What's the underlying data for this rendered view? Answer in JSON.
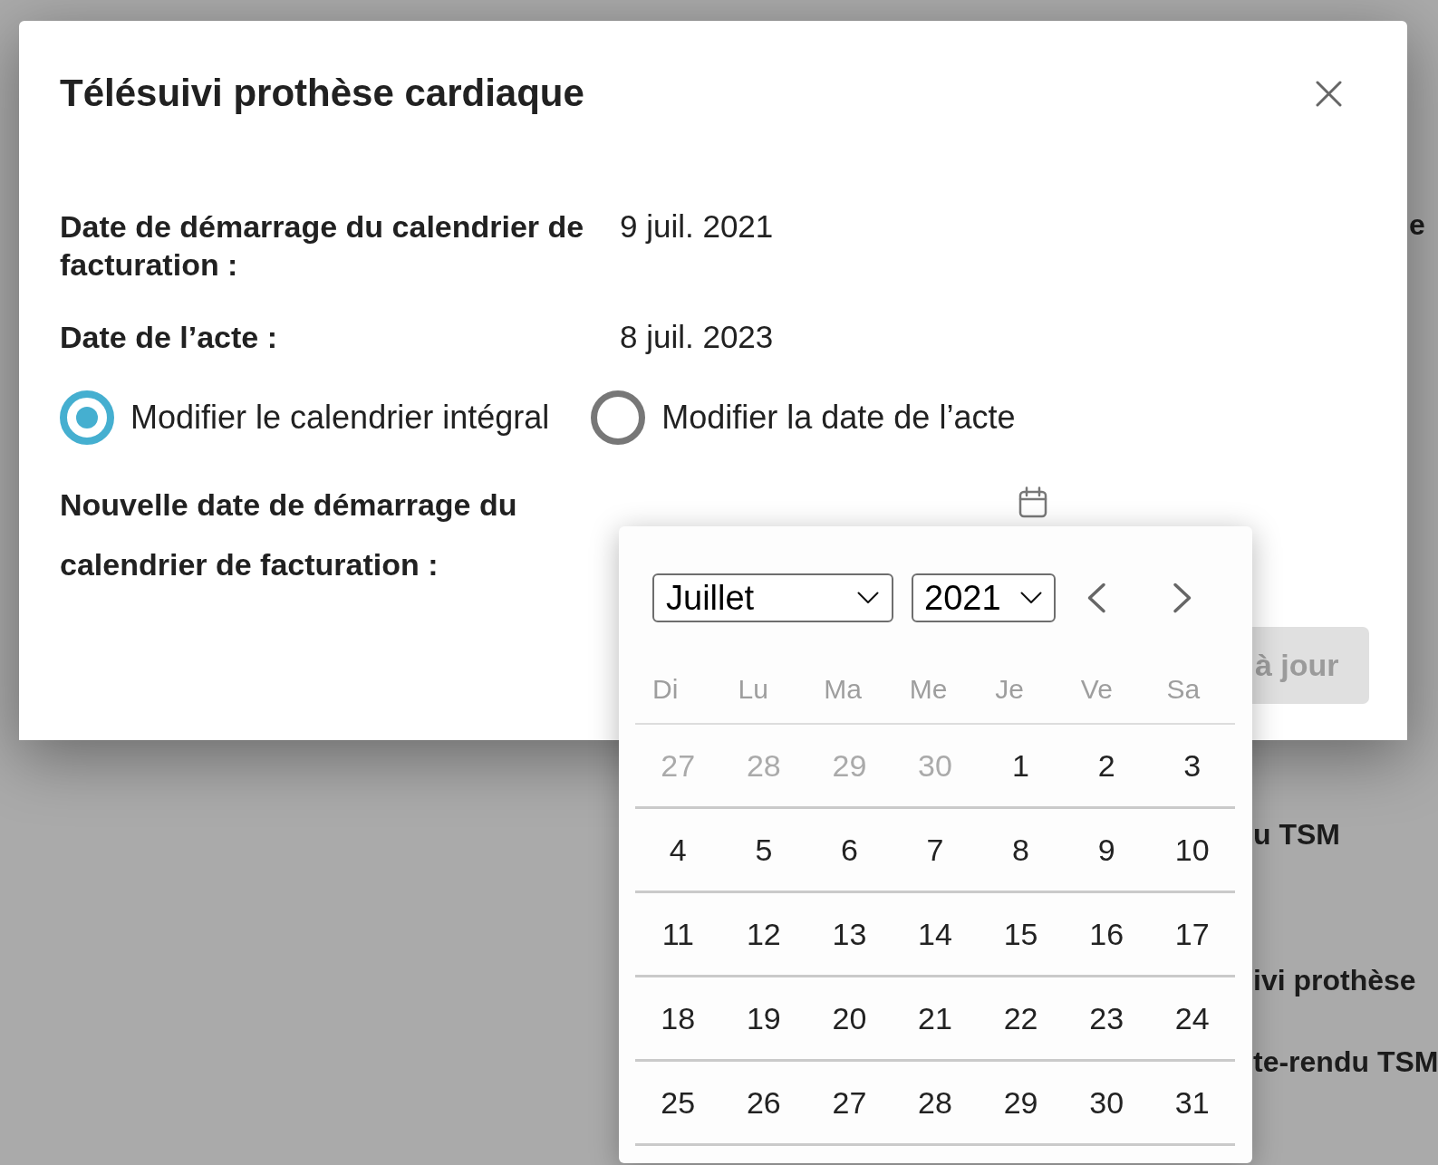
{
  "background_page": {
    "heading_fragment": "e",
    "list_fragments": [
      "u TSM",
      "ivi prothèse",
      "te-rendu TSM"
    ]
  },
  "dialog": {
    "title": "Télésuivi prothèse cardiaque",
    "fields": [
      {
        "label": "Date de démarrage du calendrier de facturation :",
        "value": "9 juil. 2021"
      },
      {
        "label": "Date de l’acte :",
        "value": "8 juil. 2023"
      }
    ],
    "mode_options": [
      {
        "label": "Modifier le calendrier intégral",
        "selected": true
      },
      {
        "label": "Modifier la date de l’acte",
        "selected": false
      }
    ],
    "new_start_date": {
      "label": "Nouvelle date de démarrage du calendrier de facturation :"
    },
    "submit_button": {
      "label": "à jour",
      "disabled": true
    }
  },
  "date_picker": {
    "month": "Juillet",
    "year": "2021",
    "weekdays": [
      "Di",
      "Lu",
      "Ma",
      "Me",
      "Je",
      "Ve",
      "Sa"
    ],
    "weeks": [
      [
        {
          "day": "27",
          "other_month": true
        },
        {
          "day": "28",
          "other_month": true
        },
        {
          "day": "29",
          "other_month": true
        },
        {
          "day": "30",
          "other_month": true
        },
        {
          "day": "1",
          "other_month": false
        },
        {
          "day": "2",
          "other_month": false
        },
        {
          "day": "3",
          "other_month": false
        }
      ],
      [
        {
          "day": "4",
          "other_month": false
        },
        {
          "day": "5",
          "other_month": false
        },
        {
          "day": "6",
          "other_month": false
        },
        {
          "day": "7",
          "other_month": false
        },
        {
          "day": "8",
          "other_month": false
        },
        {
          "day": "9",
          "other_month": false
        },
        {
          "day": "10",
          "other_month": false
        }
      ],
      [
        {
          "day": "11",
          "other_month": false
        },
        {
          "day": "12",
          "other_month": false
        },
        {
          "day": "13",
          "other_month": false
        },
        {
          "day": "14",
          "other_month": false
        },
        {
          "day": "15",
          "other_month": false
        },
        {
          "day": "16",
          "other_month": false
        },
        {
          "day": "17",
          "other_month": false
        }
      ],
      [
        {
          "day": "18",
          "other_month": false
        },
        {
          "day": "19",
          "other_month": false
        },
        {
          "day": "20",
          "other_month": false
        },
        {
          "day": "21",
          "other_month": false
        },
        {
          "day": "22",
          "other_month": false
        },
        {
          "day": "23",
          "other_month": false
        },
        {
          "day": "24",
          "other_month": false
        }
      ],
      [
        {
          "day": "25",
          "other_month": false
        },
        {
          "day": "26",
          "other_month": false
        },
        {
          "day": "27",
          "other_month": false
        },
        {
          "day": "28",
          "other_month": false
        },
        {
          "day": "29",
          "other_month": false
        },
        {
          "day": "30",
          "other_month": false
        },
        {
          "day": "31",
          "other_month": false
        }
      ]
    ]
  }
}
